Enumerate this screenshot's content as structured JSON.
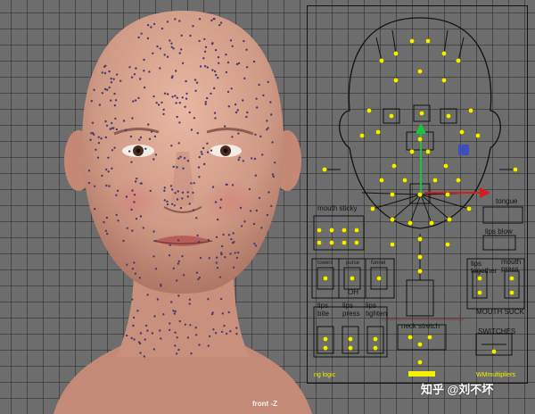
{
  "viewport": {
    "camera_label": "front -Z"
  },
  "panel": {
    "labels": {
      "mouth_sticky": "mouth sticky",
      "tongue": "tongue",
      "lips_blow": "lips blow",
      "lower": "lowers",
      "purse": "purse",
      "funnel": "funnel",
      "oh": "OH",
      "lips_together": "lips together",
      "mouth_press": "mouth press",
      "lips_bite": "lips bite",
      "lips_press": "lips press",
      "lips_tighten": "lips tighten",
      "mouth_suck": "MOUTH SUCK",
      "neck_stretch": "neck stretch",
      "switches": "SWITCHES",
      "rig_logic": "rig logic",
      "wm_multipliers": "WMmultipliers"
    }
  },
  "watermark": {
    "text": "知乎 @刘不坏"
  },
  "colors": {
    "grid": "#6d6d6d",
    "control_dot": "#f6f000",
    "skin": "#d8a390",
    "manipulator_green": "#19c43a",
    "manipulator_red": "#d41d1d",
    "manipulator_blue": "#3f4fb8"
  }
}
